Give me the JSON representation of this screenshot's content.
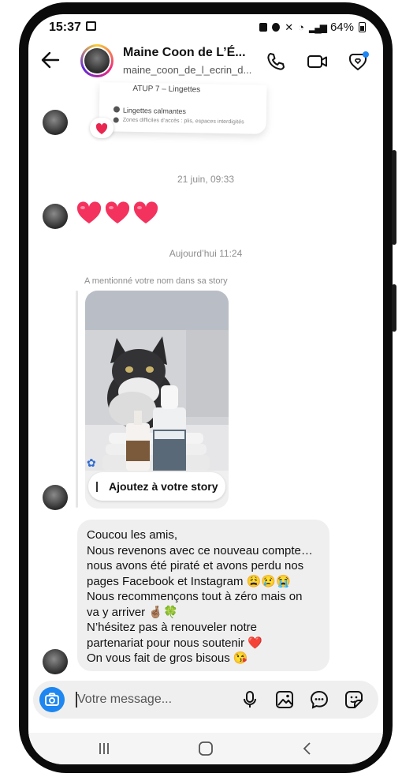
{
  "status_bar": {
    "time": "15:37",
    "battery": "64%"
  },
  "header": {
    "name": "Maine Coon de L’É...",
    "handle": "maine_coon_de_l_ecrin_d..."
  },
  "shared_post": {
    "line1": "ATUP 7 – Lingettes",
    "line2": "Lingettes calmantes",
    "line3": "Zones difficiles d’accès : plis, espaces interdigités"
  },
  "timestamps": {
    "first": "21 juin, 09:33",
    "second": "Aujourd’hui 11:24"
  },
  "hearts_message": "❤️❤️❤️",
  "story_mention": {
    "label": "A mentionné votre nom dans sa story",
    "add_button": "Ajoutez à votre story"
  },
  "message": {
    "lines": [
      "Coucou les amis,",
      "Nous revenons avec ce nouveau compte…",
      "nous avons été piraté et avons perdu nos",
      "pages Facebook et Instagram 😩😢😭",
      "Nous recommençons tout à zéro mais on",
      "va y arriver 🤞🏽🍀",
      "N’hésitez pas à renouveler notre",
      "partenariat pour nous soutenir ❤️",
      "On vous fait de gros bisous 😘"
    ]
  },
  "composer": {
    "placeholder": "Votre message..."
  },
  "colors": {
    "accent": "#1d86f0",
    "bubble": "#efefef",
    "heart": "#e8264f"
  },
  "icons": {
    "back": "arrow-left-icon",
    "call": "phone-icon",
    "video": "video-camera-icon",
    "heart_shield": "heart-tag-icon",
    "camera": "camera-icon",
    "mic": "microphone-icon",
    "gallery": "image-icon",
    "chat": "chat-bubble-icon",
    "sticker": "sticker-icon"
  }
}
